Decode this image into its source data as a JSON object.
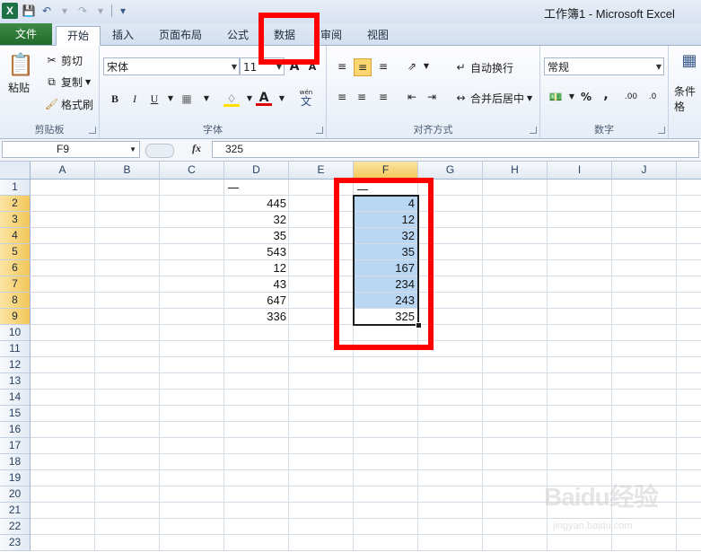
{
  "window": {
    "title": "工作簿1 - Microsoft Excel"
  },
  "tabs": [
    {
      "label": "文件"
    },
    {
      "label": "开始"
    },
    {
      "label": "插入"
    },
    {
      "label": "页面布局"
    },
    {
      "label": "公式"
    },
    {
      "label": "数据"
    },
    {
      "label": "审阅"
    },
    {
      "label": "视图"
    }
  ],
  "clipboard": {
    "paste": "粘贴",
    "cut": "剪切",
    "copy": "复制",
    "format_painter": "格式刷",
    "label": "剪贴板"
  },
  "font": {
    "name": "宋体",
    "size": "11",
    "grow": "A",
    "shrink": "A",
    "bold": "B",
    "italic": "I",
    "underline": "U",
    "phonetic_top": "wén",
    "phonetic_bottom": "文",
    "color_letter": "A",
    "label": "字体"
  },
  "alignment": {
    "wrap_text": "自动换行",
    "merge_center": "合并后居中",
    "label": "对齐方式"
  },
  "number": {
    "format": "常规",
    "percent": "%",
    "comma": ",",
    "inc_decimal": ".00",
    "dec_decimal": ".0",
    "label": "数字"
  },
  "styles": {
    "conditional": "条件格"
  },
  "formula_bar": {
    "name_box": "F9",
    "fx": "fx",
    "value": "325"
  },
  "columns": [
    "A",
    "B",
    "C",
    "D",
    "E",
    "F",
    "G",
    "H",
    "I",
    "J"
  ],
  "rows": [
    "1",
    "2",
    "3",
    "4",
    "5",
    "6",
    "7",
    "8",
    "9",
    "10",
    "11",
    "12",
    "13",
    "14",
    "15",
    "16",
    "17",
    "18",
    "19",
    "20",
    "21",
    "22",
    "23"
  ],
  "column_d_values": [
    "445",
    "32",
    "35",
    "543",
    "12",
    "43",
    "647",
    "336"
  ],
  "column_f_values": [
    "4",
    "12",
    "32",
    "35",
    "167",
    "234",
    "243",
    "325"
  ],
  "watermark": {
    "main": "Baidu经验",
    "sub": "jingyan.baidu.com"
  },
  "colors": {
    "file_tab": "#2e7d32",
    "selection": "#b9d7f3",
    "highlight_box": "#ff0000",
    "header_selected": "#f3c65a"
  }
}
